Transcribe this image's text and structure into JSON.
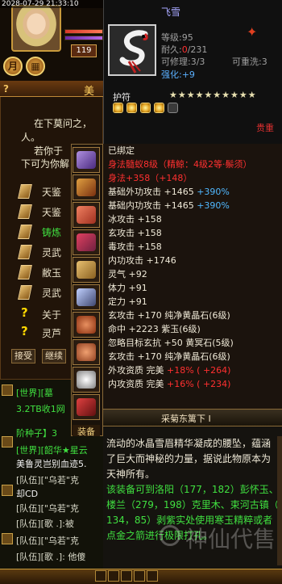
{
  "hud": {
    "timestamp": "2028-07-29 21:33:10",
    "level": "119",
    "moon_glyph": "月",
    "menu_glyph": "▦"
  },
  "quest": {
    "help": "?",
    "title": "美",
    "lines": [
      "在下莫问之，",
      "人。",
      "若你于",
      "下可为你解"
    ],
    "items": [
      "天鉴",
      "天鉴",
      "铸炼",
      "灵武",
      "敝玉",
      "灵武"
    ],
    "about": "关于",
    "spirit": "灵芦",
    "accept": "接受",
    "continue": "继续"
  },
  "chat": {
    "lines": [
      {
        "text": "[世界][墓",
        "color": "green"
      },
      {
        "text": "3.2TB收1网",
        "color": "green"
      },
      {
        "text": "阶种子】3",
        "color": "green"
      },
      {
        "text": "[世界][韶华★星云",
        "color": "green"
      },
      {
        "text": "美鲁灵岂别血迹5.",
        "color": "white"
      },
      {
        "text": "[队伍][\"乌若\"克",
        "color": "gray"
      },
      {
        "text": "却CD",
        "color": "white"
      },
      {
        "text": "[队伍][\"乌若\"克",
        "color": "gray"
      },
      {
        "text": "[队伍][歌 .]:被",
        "color": "gray"
      },
      {
        "text": "[队伍][\"乌若\"克",
        "color": "gray"
      },
      {
        "text": "[队伍][歌 .]: 他傻",
        "color": "gray"
      }
    ]
  },
  "equip": {
    "label": "装备",
    "slot_icons": [
      "feather-icon",
      "scroll-icon",
      "bell-icon",
      "sword-icon",
      "armor-icon",
      "boots-icon",
      "ring-icon",
      "ring-icon",
      "bracelet-icon",
      "necklace-icon"
    ]
  },
  "item": {
    "name": "飞雪",
    "icon": "white-serpent-belt-icon",
    "level_label": "等级",
    "level_value": ":95",
    "durability_label": "耐久",
    "durability_cur": "0",
    "durability_max": "/231",
    "repair_label": "可修理",
    "repair_value": ":3/3",
    "rewash_label": "可重洗",
    "rewash_value": ":3",
    "strength_label": "强化",
    "strength_value": ":+9",
    "talisman_label": "护符",
    "stars": "★★★★★★★★★★",
    "gems": [
      "filled",
      "filled",
      "filled",
      "filled",
      "empty"
    ],
    "value_label": "贵重"
  },
  "stats": [
    {
      "text": "已绑定",
      "color": "w"
    },
    {
      "text": "身法髓蚁8级（精鲸：4级2等·鬃须）",
      "color": "r"
    },
    {
      "text": "身法+358（+148）",
      "color": "r"
    },
    {
      "text": "基础外功攻击 +1465 ",
      "hl": "+390%",
      "color": "w"
    },
    {
      "text": "基础内功攻击 +1465 ",
      "hl": "+390%",
      "color": "w"
    },
    {
      "text": "冰攻击 +158",
      "color": "w"
    },
    {
      "text": "玄攻击 +158",
      "color": "w"
    },
    {
      "text": "毒攻击 +158",
      "color": "w"
    },
    {
      "text": "内功攻击 +1746",
      "color": "w"
    },
    {
      "text": "灵气 +92",
      "color": "w"
    },
    {
      "text": "体力 +91",
      "color": "w"
    },
    {
      "text": "定力 +91",
      "color": "w"
    },
    {
      "text": "玄攻击 +170 纯净黄晶石(6级)",
      "color": "w"
    },
    {
      "text": "命中 +2223 紫玉(6级)",
      "color": "w"
    },
    {
      "text": "忽略目标玄抗 +50 黄冥石(5级)",
      "color": "w"
    },
    {
      "text": "玄攻击 +170 纯净黄晶石(6级)",
      "color": "w"
    },
    {
      "text": "外攻资质  完美 ",
      "hl": "+18% ( +264)",
      "hlc": "r",
      "color": "w"
    },
    {
      "text": "内攻资质  完美 ",
      "hl": "+16% ( +234)",
      "hlc": "r",
      "color": "w"
    }
  ],
  "set_name": "采菊东篱下 I",
  "description": [
    {
      "text": "流动的冰晶雪眉精华凝成的腰坠，蕴涵",
      "color": "w"
    },
    {
      "text": "了巨大而神秘的力量，据说此物原本为",
      "color": "w"
    },
    {
      "text": "天神所有。",
      "color": "w"
    },
    {
      "text": "该装备可到洛阳（177，182）彭怀玉、",
      "color": "g"
    },
    {
      "text": "楼兰（279，198）克里木、束河古镇（",
      "color": "g"
    },
    {
      "text": "134，85）剥紫实处使用寒玉精粹或者",
      "color": "g"
    },
    {
      "text": "点金之箭进行极限打孔。",
      "color": "g"
    }
  ],
  "watermark": "神仙代售"
}
